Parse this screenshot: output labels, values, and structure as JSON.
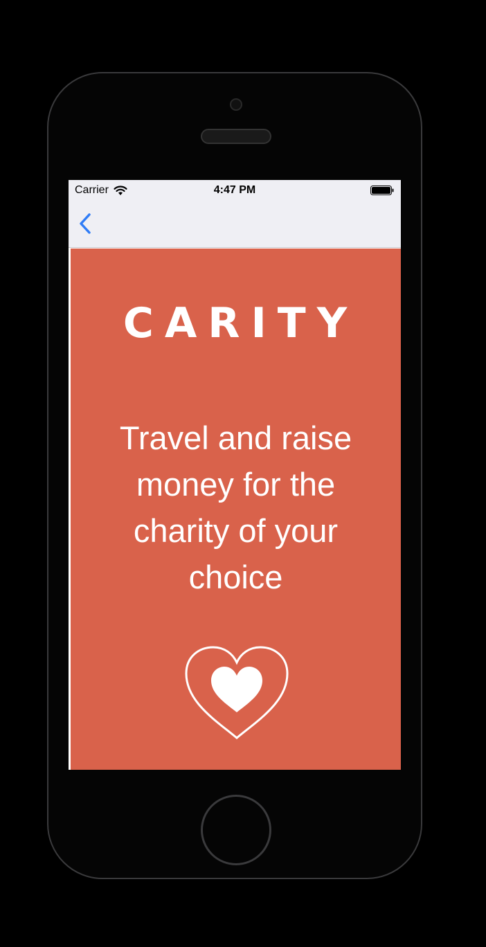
{
  "status_bar": {
    "carrier": "Carrier",
    "time": "4:47 PM",
    "wifi_icon": "wifi-icon",
    "battery_icon": "battery-icon"
  },
  "nav_bar": {
    "back_icon": "chevron-left-icon",
    "tint_color": "#2f7cf6"
  },
  "content": {
    "brand": "CARITY",
    "tagline": "Travel and raise money for the charity of your choice",
    "illustration_icon": "heart-icon",
    "background_color": "#d9624b"
  }
}
